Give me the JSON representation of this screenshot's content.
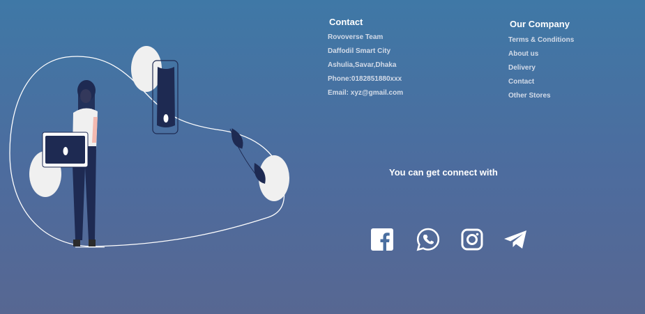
{
  "contact": {
    "title": "Contact",
    "lines": [
      "Rovoverse Team",
      "Daffodil Smart City",
      "Ashulia,Savar,Dhaka",
      "Phone:0182851880xxx",
      "Email: xyz@gmail.com"
    ]
  },
  "company": {
    "title": "Our Company",
    "links": [
      "Terms & Conditions",
      "About us",
      "Delivery",
      "Contact",
      "Other Stores"
    ]
  },
  "connect_text": "You can get connect with",
  "social_icons": [
    "facebook-icon",
    "whatsapp-icon",
    "instagram-icon",
    "telegram-icon"
  ],
  "colors": {
    "background_top": "#3f78a6",
    "background_bottom": "#576792",
    "illustration_dark": "#1e2a52",
    "illustration_light": "#f0f0f0"
  }
}
